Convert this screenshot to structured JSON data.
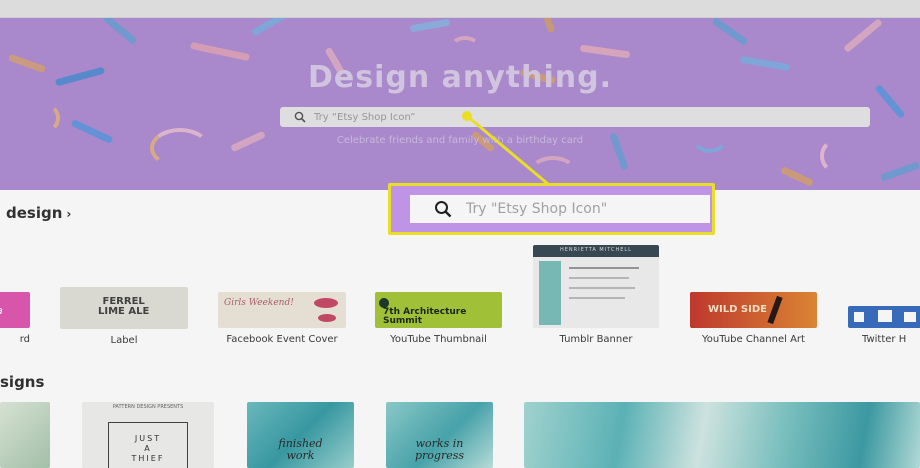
{
  "hero": {
    "title": "Design anything.",
    "search_placeholder": "Try “Etsy Shop Icon”",
    "subtitle": "Celebrate friends and family with a birthday card",
    "bg_color": "#b08ed4"
  },
  "callout": {
    "search_placeholder": "Try \"Etsy Shop Icon\"",
    "highlight_color": "#f4e72a"
  },
  "sections": {
    "create": {
      "title": "design",
      "chevron": "›"
    },
    "browse": {
      "title": "signs"
    }
  },
  "templates": [
    {
      "label": "rd"
    },
    {
      "label": "Label",
      "thumb_text": [
        "FERREL",
        "LIME ALE"
      ]
    },
    {
      "label": "Facebook Event Cover",
      "thumb_text": "Girls Weekend!"
    },
    {
      "label": "YouTube Thumbnail",
      "thumb_text": [
        "7th Architecture",
        "Summit"
      ]
    },
    {
      "label": "Tumblr Banner",
      "thumb_text": "HENRIETTA MITCHELL"
    },
    {
      "label": "YouTube Channel Art",
      "thumb_text": "WILD SIDE"
    },
    {
      "label": "Twitter H"
    }
  ],
  "browse_designs": [
    {
      "text": [
        "JUST",
        "A",
        "THIEF"
      ],
      "header": "PATTERN DESIGN PRESENTS"
    },
    {
      "text": [
        "finished",
        "work"
      ]
    },
    {
      "text": [
        "works in",
        "progress"
      ]
    }
  ]
}
